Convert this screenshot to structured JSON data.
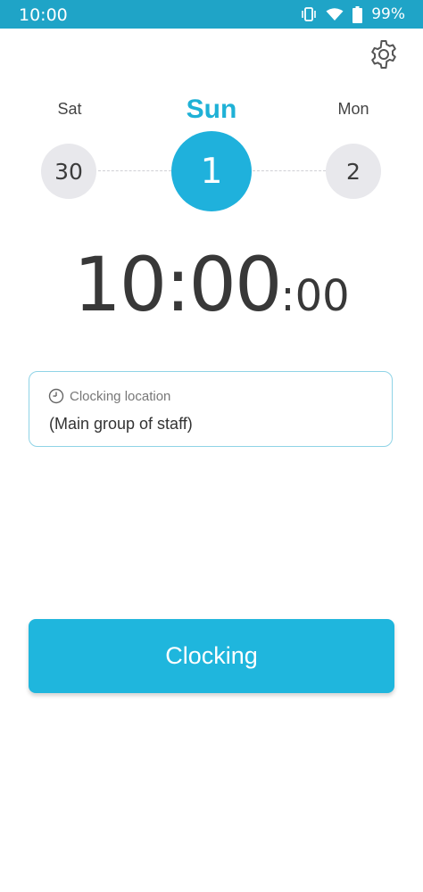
{
  "status_bar": {
    "time": "10:00",
    "battery": "99%",
    "icons": [
      "vibrate-icon",
      "wifi-icon",
      "battery-icon"
    ]
  },
  "settings": {
    "icon": "gear-icon"
  },
  "days": [
    {
      "label": "Sat",
      "date": "30",
      "selected": false
    },
    {
      "label": "Sun",
      "date": "1",
      "selected": true
    },
    {
      "label": "Mon",
      "date": "2",
      "selected": false
    }
  ],
  "clock": {
    "hours_minutes": "10:00",
    "seconds": ":00"
  },
  "location": {
    "title": "Clocking location",
    "value": "(Main group of staff)",
    "icon": "clock-icon"
  },
  "action": {
    "label": "Clocking"
  },
  "colors": {
    "status_bar": "#1fa4c7",
    "accent": "#1fb6dd",
    "inactive_circle": "#e8e8ec",
    "box_border": "#8fd3e6"
  }
}
